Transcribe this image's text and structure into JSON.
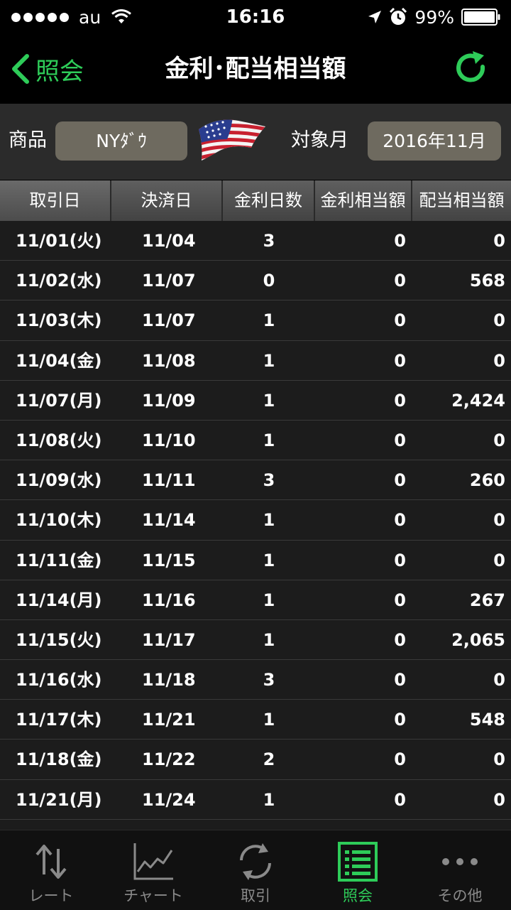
{
  "status_bar": {
    "carrier": "au",
    "time": "16:16",
    "battery": "99%"
  },
  "nav": {
    "back_label": "照会",
    "title": "金利･配当相当額"
  },
  "filters": {
    "product_label": "商品",
    "product_value": "NYﾀﾞｳ",
    "month_label": "対象月",
    "month_value": "2016年11月"
  },
  "table": {
    "headers": [
      "取引日",
      "決済日",
      "金利日数",
      "金利相当額",
      "配当相当額"
    ],
    "rows": [
      {
        "trade": "11/01(火)",
        "settle": "11/04",
        "days": "3",
        "interest": "0",
        "dividend": "0"
      },
      {
        "trade": "11/02(水)",
        "settle": "11/07",
        "days": "0",
        "interest": "0",
        "dividend": "568"
      },
      {
        "trade": "11/03(木)",
        "settle": "11/07",
        "days": "1",
        "interest": "0",
        "dividend": "0"
      },
      {
        "trade": "11/04(金)",
        "settle": "11/08",
        "days": "1",
        "interest": "0",
        "dividend": "0"
      },
      {
        "trade": "11/07(月)",
        "settle": "11/09",
        "days": "1",
        "interest": "0",
        "dividend": "2,424"
      },
      {
        "trade": "11/08(火)",
        "settle": "11/10",
        "days": "1",
        "interest": "0",
        "dividend": "0"
      },
      {
        "trade": "11/09(水)",
        "settle": "11/11",
        "days": "3",
        "interest": "0",
        "dividend": "260"
      },
      {
        "trade": "11/10(木)",
        "settle": "11/14",
        "days": "1",
        "interest": "0",
        "dividend": "0"
      },
      {
        "trade": "11/11(金)",
        "settle": "11/15",
        "days": "1",
        "interest": "0",
        "dividend": "0"
      },
      {
        "trade": "11/14(月)",
        "settle": "11/16",
        "days": "1",
        "interest": "0",
        "dividend": "267"
      },
      {
        "trade": "11/15(火)",
        "settle": "11/17",
        "days": "1",
        "interest": "0",
        "dividend": "2,065"
      },
      {
        "trade": "11/16(水)",
        "settle": "11/18",
        "days": "3",
        "interest": "0",
        "dividend": "0"
      },
      {
        "trade": "11/17(木)",
        "settle": "11/21",
        "days": "1",
        "interest": "0",
        "dividend": "548"
      },
      {
        "trade": "11/18(金)",
        "settle": "11/22",
        "days": "2",
        "interest": "0",
        "dividend": "0"
      },
      {
        "trade": "11/21(月)",
        "settle": "11/24",
        "days": "1",
        "interest": "0",
        "dividend": "0"
      }
    ]
  },
  "tabs": [
    {
      "label": "レート",
      "icon": "rate-arrows-icon"
    },
    {
      "label": "チャート",
      "icon": "chart-icon"
    },
    {
      "label": "取引",
      "icon": "trade-cycle-icon"
    },
    {
      "label": "照会",
      "icon": "inquiry-list-icon"
    },
    {
      "label": "その他",
      "icon": "more-dots-icon"
    }
  ],
  "colors": {
    "accent": "#2ecc59",
    "inactive": "#8a8a8a",
    "select_bg": "#6e6a5f"
  }
}
